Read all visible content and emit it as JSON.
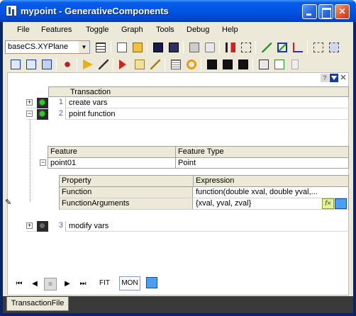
{
  "window": {
    "title": "mypoint - GenerativeComponents"
  },
  "menu": [
    "File",
    "Features",
    "Toggle",
    "Graph",
    "Tools",
    "Debug",
    "Help"
  ],
  "toolbar": {
    "view_select": "baseCS.XYPlane"
  },
  "transaction_panel": {
    "column_header": "Transaction",
    "rows": [
      {
        "number": "1",
        "name": "create vars",
        "expander": "+",
        "status": "active"
      },
      {
        "number": "2",
        "name": "point function",
        "expander": "−",
        "status": "active"
      },
      {
        "number": "3",
        "name": "modify vars",
        "expander": "+",
        "status": "inactive"
      }
    ]
  },
  "feature_grid": {
    "headers": [
      "Feature",
      "Feature Type"
    ],
    "row": {
      "expander": "−",
      "feature": "point01",
      "type": "Point"
    }
  },
  "property_grid": {
    "headers": [
      "Property",
      "Expression"
    ],
    "rows": [
      {
        "property": "Function",
        "expression": "function(double  xval,  double  yval,..."
      },
      {
        "property": "FunctionArguments",
        "expression": "{xval, yval, zval}"
      }
    ]
  },
  "navigator": {
    "fit_label": "FIT",
    "mon_label": "MON"
  },
  "bottom_tab": {
    "label": "TransactionFile"
  },
  "colors": {
    "titlebar": "#0055e5",
    "window_bg": "#ece9d8",
    "status_active": "#27d21f"
  }
}
